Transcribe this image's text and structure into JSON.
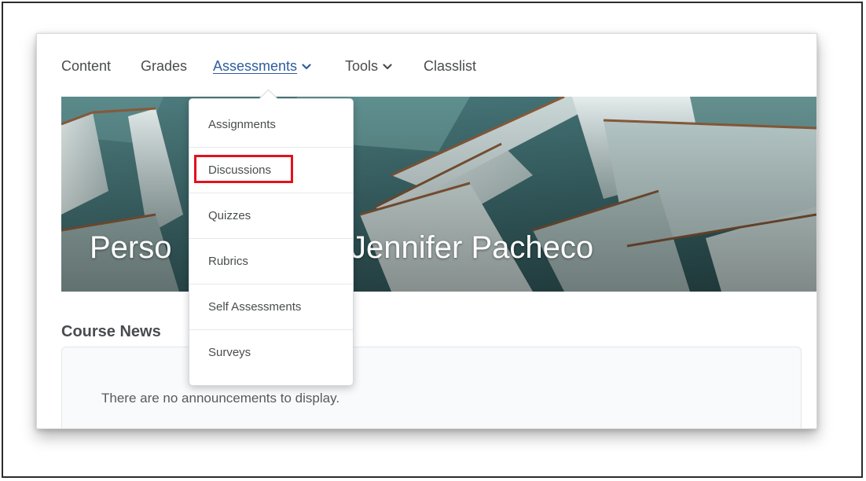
{
  "nav": {
    "items": [
      {
        "label": "Content"
      },
      {
        "label": "Grades"
      },
      {
        "label": "Assessments"
      },
      {
        "label": "Tools"
      },
      {
        "label": "Classlist"
      }
    ],
    "active": "Assessments"
  },
  "hero": {
    "title": "Personal Sandbox - Jennifer Pacheco",
    "visible_title_left": "Perso",
    "visible_title_right": "x - Jennifer Pacheco"
  },
  "dropdown": {
    "items": [
      {
        "label": "Assignments"
      },
      {
        "label": "Discussions",
        "highlighted": true
      },
      {
        "label": "Quizzes"
      },
      {
        "label": "Rubrics"
      },
      {
        "label": "Self Assessments"
      },
      {
        "label": "Surveys"
      }
    ]
  },
  "news": {
    "heading": "Course News",
    "empty_text": "There are no announcements to display."
  },
  "colors": {
    "link_active": "#2f5c9e",
    "highlight": "#e2121c",
    "text": "#494c4e"
  }
}
